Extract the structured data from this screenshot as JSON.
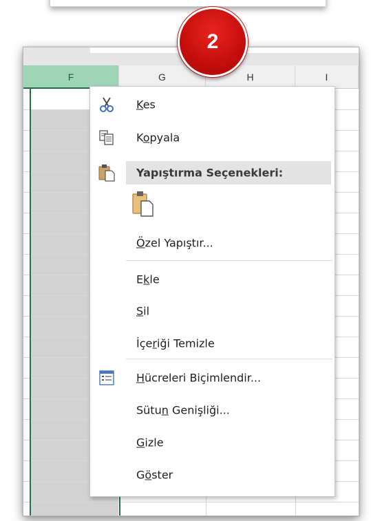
{
  "badge": {
    "number": "2"
  },
  "columns": [
    "F",
    "G",
    "H",
    "I"
  ],
  "menu": {
    "cut": {
      "pre": "",
      "accel": "K",
      "post": "es"
    },
    "copy": {
      "pre": "K",
      "accel": "o",
      "post": "pyala"
    },
    "paste_options_header": "Yapıştırma Seçenekleri:",
    "paste_special": {
      "pre": "",
      "accel": "Ö",
      "post": "zel Yapıştır..."
    },
    "insert": {
      "pre": "E",
      "accel": "k",
      "post": "le"
    },
    "delete": {
      "pre": "",
      "accel": "S",
      "post": "il"
    },
    "clear_contents": {
      "pre": "İçe",
      "accel": "r",
      "post": "iği Temizle"
    },
    "format_cells": {
      "pre": "",
      "accel": "H",
      "post": "ücreleri Biçimlendir..."
    },
    "column_width": {
      "pre": "Sütu",
      "accel": "n",
      "post": " Genişliği..."
    },
    "hide": {
      "pre": "",
      "accel": "G",
      "post": "izle"
    },
    "unhide": {
      "pre": "G",
      "accel": "ö",
      "post": "ster"
    }
  },
  "icons": {
    "cut": "scissors-icon",
    "copy": "copy-icon",
    "paste_header": "clipboard-icon",
    "paste_option": "paste-icon",
    "format_cells": "format-cells-icon"
  },
  "colors": {
    "selected_column": "#9fd5b7",
    "selection_border": "#217346",
    "badge": "#c40e0c"
  }
}
